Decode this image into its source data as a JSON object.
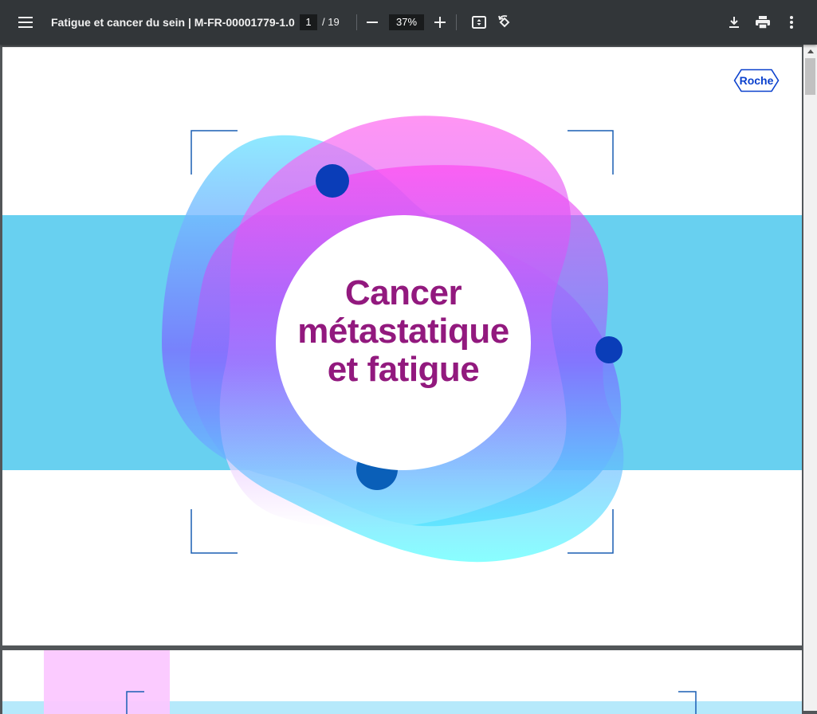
{
  "toolbar": {
    "title": "Fatigue et cancer du sein | M-FR-00001779-1.0",
    "page_current": "1",
    "page_total": "/ 19",
    "zoom": "37%",
    "icons": [
      "menu-icon",
      "zoom-out-icon",
      "zoom-in-icon",
      "fit-page-icon",
      "rotate-icon",
      "download-icon",
      "print-icon",
      "more-icon"
    ]
  },
  "page1": {
    "logo_text": "Roche",
    "title_lines": [
      "Cancer",
      "métastatique",
      "et fatigue"
    ]
  },
  "colors": {
    "toolbar_bg": "#323639",
    "band": "#68d0f0",
    "title": "#92197e",
    "logo": "#0b41cd",
    "dot": "#0a3db8"
  }
}
